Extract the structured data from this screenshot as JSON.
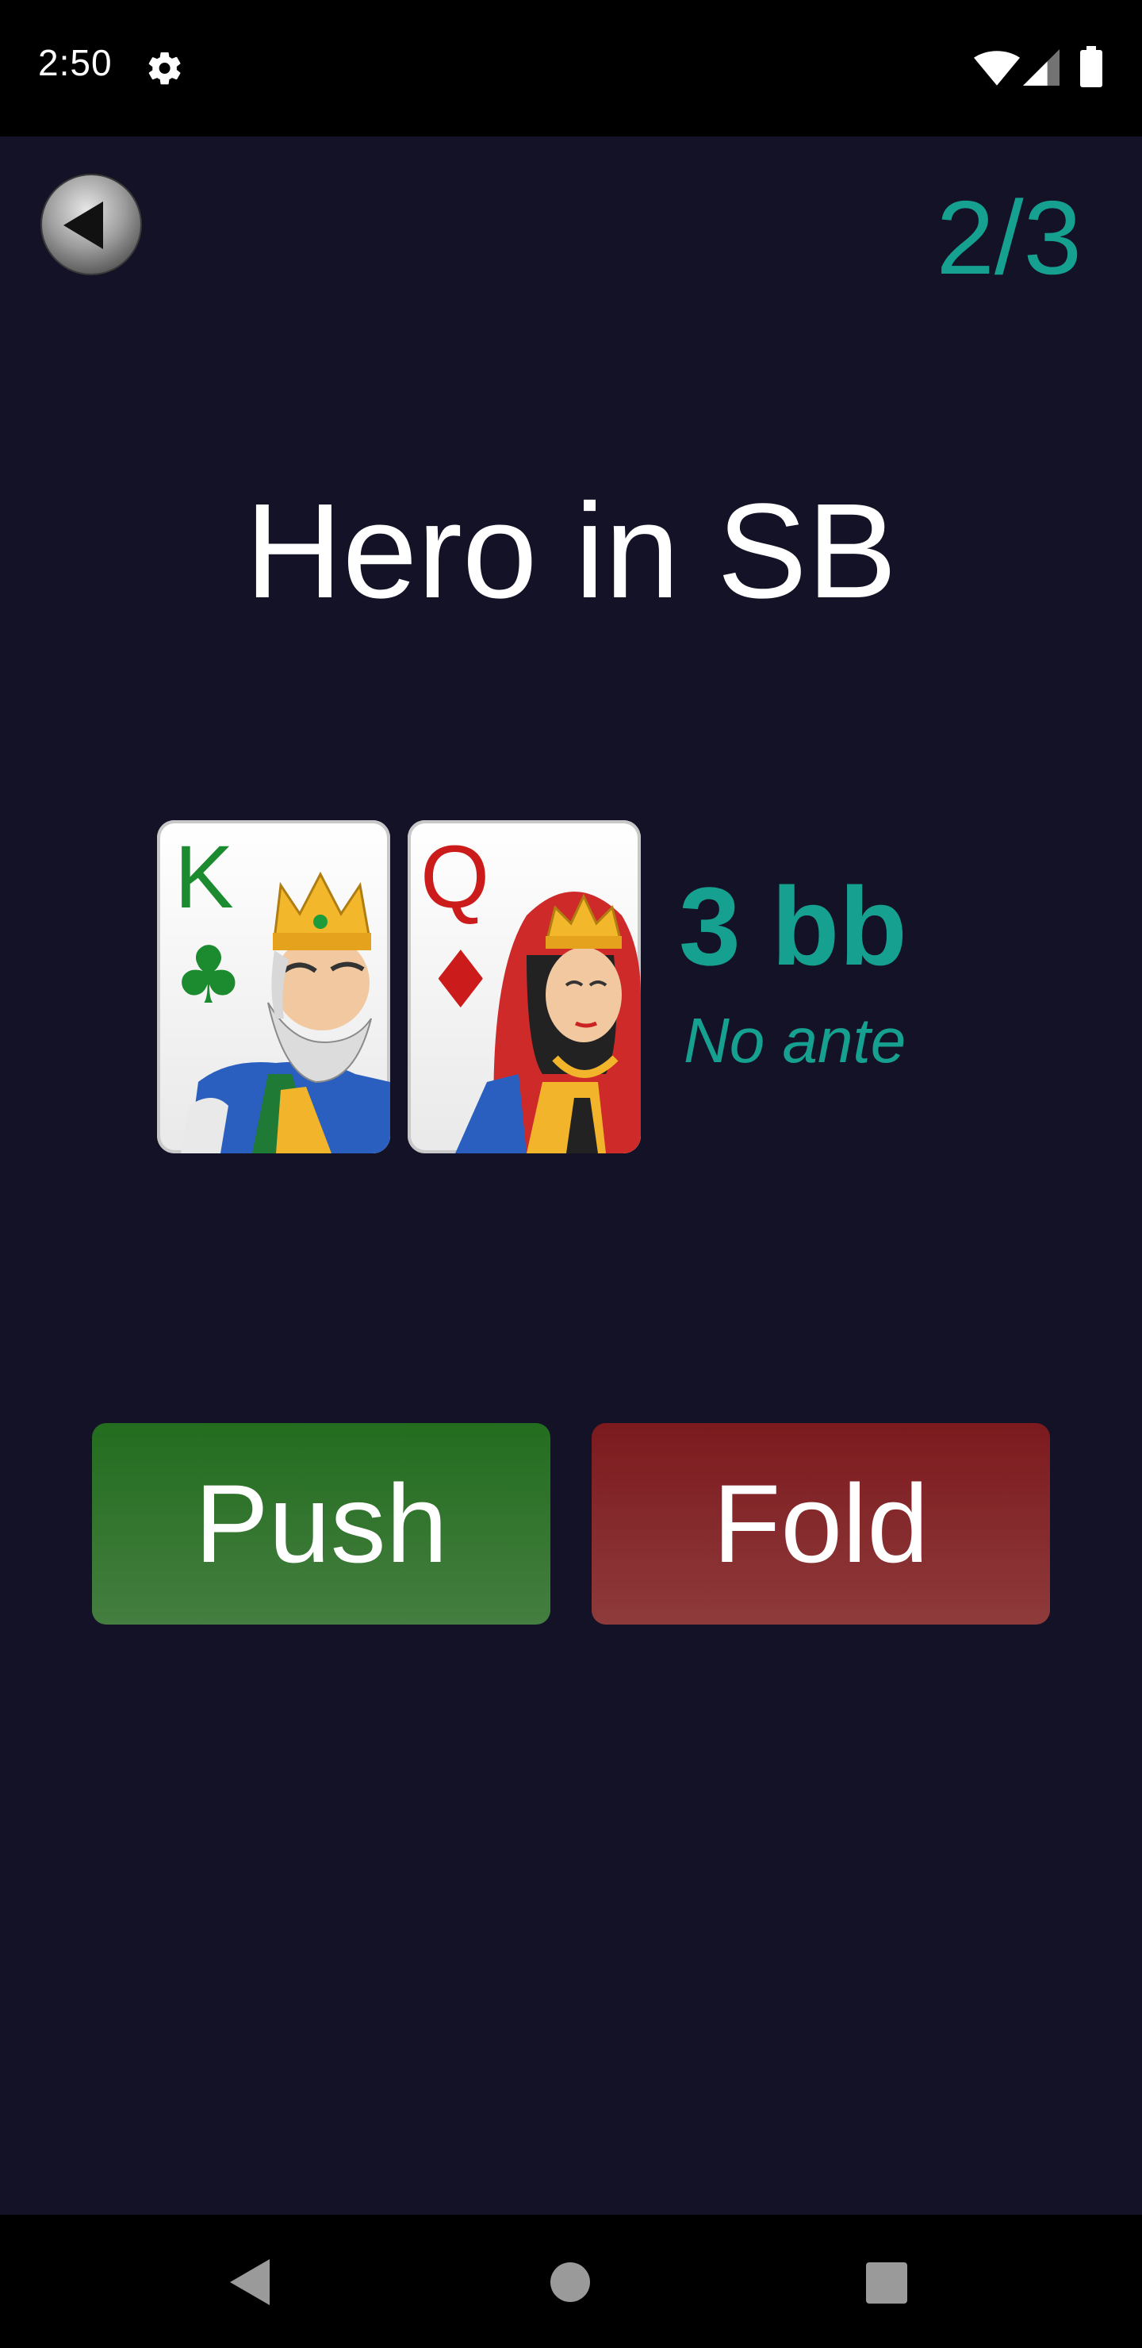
{
  "status_bar": {
    "time": "2:50",
    "icons": [
      "gear-icon",
      "wifi-icon",
      "cell-signal-icon",
      "battery-icon"
    ]
  },
  "header": {
    "back_icon": "back-arrow-icon",
    "progress": "2/3"
  },
  "hand": {
    "title": "Hero in SB",
    "cards": [
      {
        "rank": "K",
        "suit": "clubs",
        "suit_symbol": "♣",
        "color": "#1c8a2e"
      },
      {
        "rank": "Q",
        "suit": "diamonds",
        "suit_symbol": "♦",
        "color": "#cc1b1b"
      }
    ],
    "stack": "3 bb",
    "ante": "No ante"
  },
  "actions": {
    "push_label": "Push",
    "fold_label": "Fold"
  },
  "colors": {
    "background": "#141226",
    "accent": "#15a08f",
    "push": "#2e7329",
    "fold": "#842528"
  },
  "nav_bar": {
    "icons": [
      "nav-back-icon",
      "nav-home-icon",
      "nav-recents-icon"
    ]
  }
}
